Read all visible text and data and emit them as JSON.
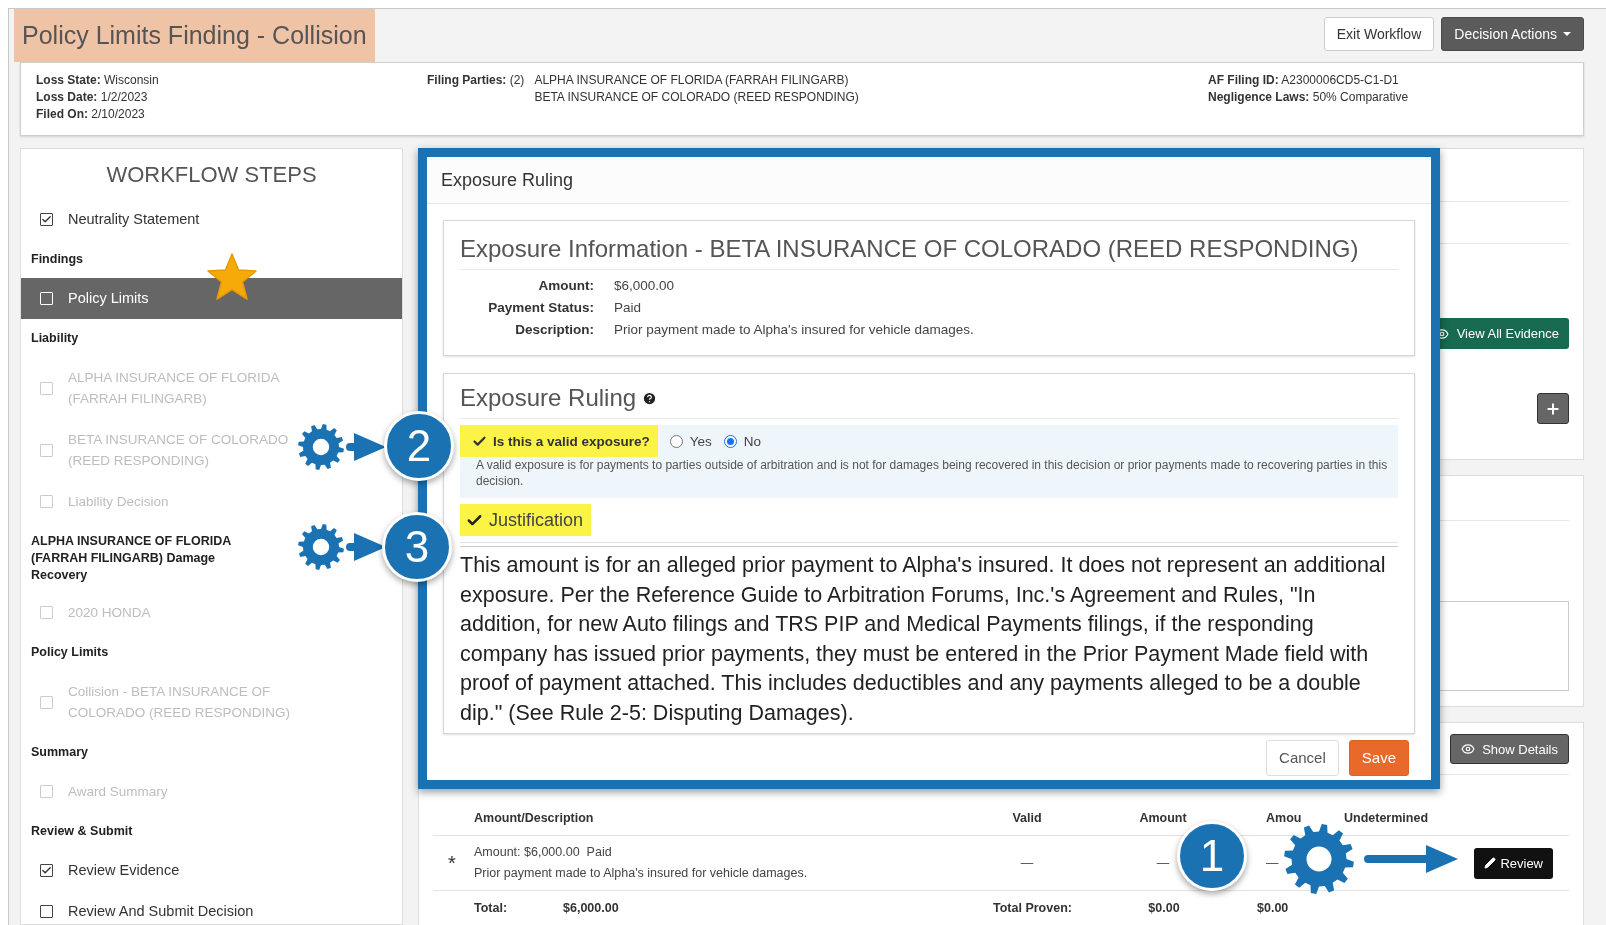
{
  "header": {
    "title": "Policy Limits Finding - Collision",
    "buttons": [
      {
        "label": "Exit Workflow",
        "kind": "secondary"
      },
      {
        "label": "Decision Actions",
        "kind": "dropdown"
      }
    ]
  },
  "claim_info": {
    "left": [
      {
        "label": "Loss State:",
        "value": "Wisconsin"
      },
      {
        "label": "Loss Date:",
        "value": "1/2/2023"
      },
      {
        "label": "Filed On:",
        "value": "2/10/2023"
      }
    ],
    "filing_parties": {
      "label": "Filing Parties:",
      "count": "(2)",
      "parties": [
        "ALPHA INSURANCE OF FLORIDA (FARRAH FILINGARB)",
        "BETA INSURANCE OF COLORADO (REED RESPONDING)"
      ]
    },
    "right": [
      {
        "label": "AF Filing ID:",
        "value": "A2300006CD5-C1-D1"
      },
      {
        "label": "Negligence Laws:",
        "value": "50% Comparative"
      }
    ]
  },
  "sidebar": {
    "title": "WORKFLOW STEPS",
    "steps": [
      {
        "kind": "step",
        "label": "Neutrality Statement",
        "checked": true,
        "selected": false,
        "disabled": false
      },
      {
        "kind": "heading",
        "label": "Findings"
      },
      {
        "kind": "step",
        "label": "Policy Limits",
        "checked": false,
        "selected": true,
        "disabled": false
      },
      {
        "kind": "heading",
        "label": "Liability"
      },
      {
        "kind": "step",
        "label": "ALPHA INSURANCE OF FLORIDA (FARRAH FILINGARB)",
        "checked": false,
        "selected": false,
        "disabled": true
      },
      {
        "kind": "step",
        "label": "BETA INSURANCE OF COLORADO (REED RESPONDING)",
        "checked": false,
        "selected": false,
        "disabled": true
      },
      {
        "kind": "step",
        "label": "Liability Decision",
        "checked": false,
        "selected": false,
        "disabled": true
      },
      {
        "kind": "heading",
        "label": "ALPHA INSURANCE OF FLORIDA (FARRAH FILINGARB) Damage Recovery"
      },
      {
        "kind": "step",
        "label": "2020 HONDA",
        "checked": false,
        "selected": false,
        "disabled": true
      },
      {
        "kind": "heading",
        "label": "Policy Limits"
      },
      {
        "kind": "step",
        "label": "Collision - BETA INSURANCE OF COLORADO (REED RESPONDING)",
        "checked": false,
        "selected": false,
        "disabled": true
      },
      {
        "kind": "heading",
        "label": "Summary"
      },
      {
        "kind": "step",
        "label": "Award Summary",
        "checked": false,
        "selected": false,
        "disabled": true
      },
      {
        "kind": "heading",
        "label": "Review & Submit"
      },
      {
        "kind": "step",
        "label": "Review Evidence",
        "checked": true,
        "selected": false,
        "disabled": false
      },
      {
        "kind": "step",
        "label": "Review And Submit Decision",
        "checked": false,
        "selected": false,
        "disabled": false
      }
    ]
  },
  "evidence_panel": {
    "button": "View All Evidence"
  },
  "damages_panel": {
    "button": "Show Details",
    "table": {
      "columns": [
        "Amount/Description",
        "Valid",
        "Amount",
        "Amou",
        "Undetermined"
      ],
      "rows": [
        {
          "marker": "*",
          "amount": "Amount: $6,000.00",
          "status": "Paid",
          "description": "Prior payment made to Alpha's insured for vehicle damages.",
          "valid": "—",
          "amount_value": "—",
          "column_4": "—",
          "action": "Review"
        }
      ],
      "totals": {
        "label": "Total:",
        "value": "$6,000.00",
        "proven_label": "Total Proven:",
        "proven": "$0.00",
        "column_4": "$0.00"
      }
    }
  },
  "exposure_modal": {
    "title": "Exposure Ruling",
    "info": {
      "title": "Exposure Information - BETA INSURANCE OF COLORADO (REED RESPONDING)",
      "fields": [
        {
          "label": "Amount:",
          "value": "$6,000.00"
        },
        {
          "label": "Payment Status:",
          "value": "Paid"
        },
        {
          "label": "Description:",
          "value": "Prior payment made to Alpha's insured for vehicle damages."
        }
      ]
    },
    "ruling": {
      "title": "Exposure Ruling",
      "question": {
        "label": "Is this a valid exposure?",
        "highlighted": true,
        "options": [
          {
            "label": "Yes",
            "selected": false
          },
          {
            "label": "No",
            "selected": true
          }
        ],
        "help": "A valid exposure is for payments to parties outside of arbitration and is not for damages being recovered in this decision or prior payments made to recovering parties in this decision."
      },
      "justification": {
        "label": "Justification",
        "highlighted": true,
        "value": "This amount is for an alleged prior payment to Alpha's insured. It does not represent an additional exposure. Per the Reference Guide to Arbitration Forums, Inc.'s Agreement and Rules, \"In addition, for new Auto filings and TRS PIP and Medical Payments filings, if the responding company has issued prior payments, they must be entered in the Prior Payment Made field with proof of payment attached. This includes deductibles and any payments alleged to be a double dip.\" (See Rule 2-5: Disputing Damages)."
      }
    },
    "buttons": [
      {
        "label": "Cancel",
        "kind": "secondary"
      },
      {
        "label": "Save",
        "kind": "primary"
      }
    ]
  },
  "callouts": [
    {
      "label": "2"
    },
    {
      "label": "3"
    },
    {
      "label": "1"
    }
  ]
}
